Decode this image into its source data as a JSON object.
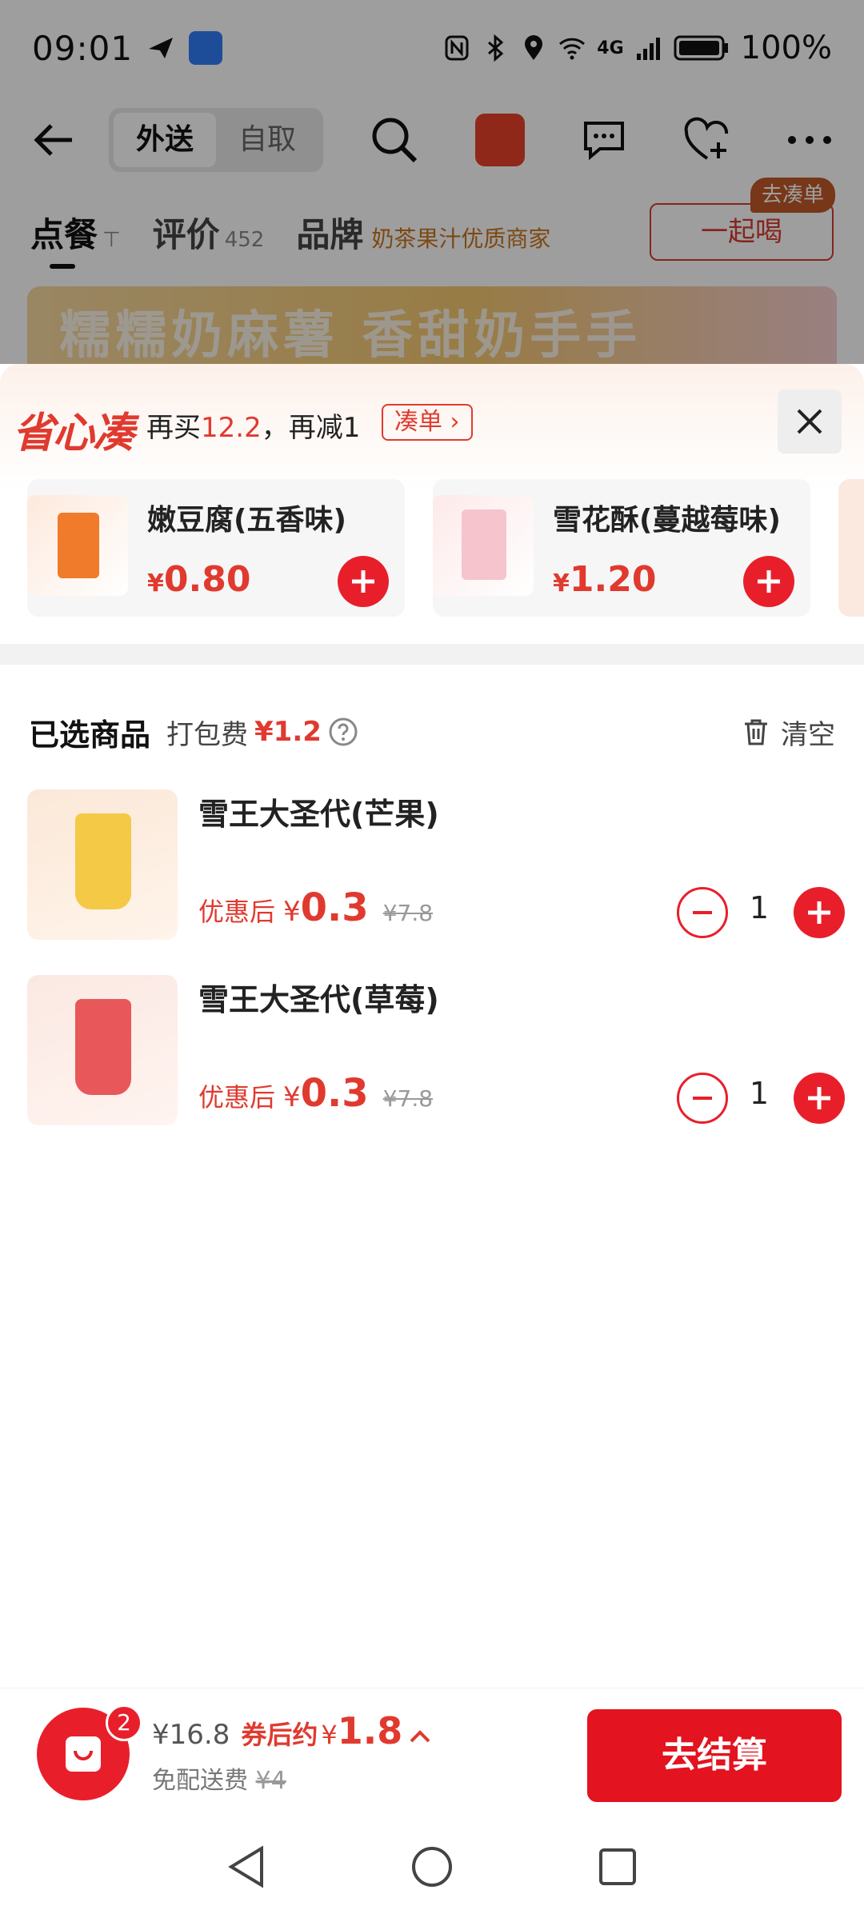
{
  "status_bar": {
    "time": "09:01",
    "network": "4G",
    "battery": "100%"
  },
  "top_bar": {
    "tabs": [
      "外送",
      "自取"
    ],
    "active_tab": "外送"
  },
  "store_tabs": {
    "order": "点餐",
    "reviews": "评价",
    "reviews_count": "452",
    "brand": "品牌",
    "brand_slogan": "奶茶果汁优质商家",
    "drink_together": "一起喝",
    "drink_together_tag": "去凑单"
  },
  "banner": {
    "text": "糯糯奶麻薯 香甜奶手手"
  },
  "promo": {
    "logo": "省心凑",
    "text_prefix": "再买",
    "amount": "12.2",
    "text_suffix": "，再减1",
    "cta": "凑单 ›"
  },
  "recommend": [
    {
      "name": "嫩豆腐(五香味)",
      "yen": "¥",
      "price": "0.80"
    },
    {
      "name": "雪花酥(蔓越莓味)",
      "yen": "¥",
      "price": "1.20"
    }
  ],
  "selected": {
    "title": "已选商品",
    "fee_label": "打包费",
    "fee_value": "¥1.2",
    "clear": "清空"
  },
  "items": [
    {
      "name": "雪王大圣代(芒果)",
      "discount_label": "优惠后",
      "yen": "¥",
      "price": "0.3",
      "original": "¥7.8",
      "qty": "1",
      "accent": "#f4c945"
    },
    {
      "name": "雪王大圣代(草莓)",
      "discount_label": "优惠后",
      "yen": "¥",
      "price": "0.3",
      "original": "¥7.8",
      "qty": "1",
      "accent": "#e8585a"
    }
  ],
  "cart": {
    "badge": "2",
    "total": "¥16.8",
    "after_label": "券后约",
    "after_yen": "¥",
    "after_value": "1.8",
    "shipping_label": "免配送费",
    "shipping_original": "¥4",
    "checkout": "去结算"
  },
  "colors": {
    "primary": "#e81f2a",
    "text_red": "#e03a2f"
  }
}
